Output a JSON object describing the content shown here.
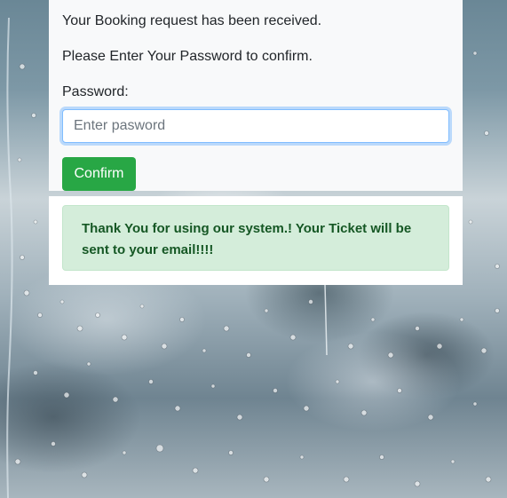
{
  "booking": {
    "received_text": "Your Booking request has been received.",
    "instruction_text": "Please Enter Your Password to confirm.",
    "password_label": "Password:",
    "password_placeholder": "Enter pasword",
    "password_value": "",
    "confirm_button_label": "Confirm"
  },
  "alert": {
    "message": "Thank You for using our system.! Your Ticket will be sent to your email!!!!"
  },
  "colors": {
    "confirm_button_bg": "#28a745",
    "alert_bg": "#d4edda",
    "alert_text": "#155724",
    "input_focus_border": "#80bdff"
  }
}
